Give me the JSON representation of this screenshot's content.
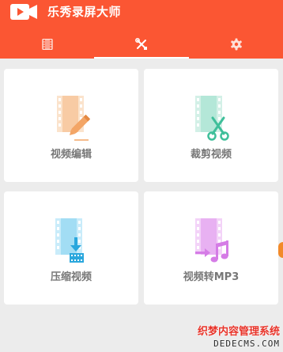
{
  "app": {
    "title": "乐秀录屏大师",
    "logo_icon": "video-camera-icon",
    "brand_color": "#fb5633"
  },
  "tabs": [
    {
      "name": "video-list",
      "icon": "film-icon",
      "active": false
    },
    {
      "name": "tools",
      "icon": "tools-icon",
      "active": true
    },
    {
      "name": "settings",
      "icon": "gear-icon",
      "active": false
    }
  ],
  "tools": [
    {
      "label": "视频编辑",
      "icon": "video-edit-icon",
      "color": "#f5b98c"
    },
    {
      "label": "裁剪视频",
      "icon": "video-cut-icon",
      "color": "#6fd1b5"
    },
    {
      "label": "压缩视频",
      "icon": "video-compress-icon",
      "color": "#4fbde8"
    },
    {
      "label": "视频转MP3",
      "icon": "video-to-mp3-icon",
      "color": "#d98ae8"
    }
  ],
  "watermark": {
    "line1": "织梦内容管理系统",
    "line2": "DEDECMS.COM"
  }
}
